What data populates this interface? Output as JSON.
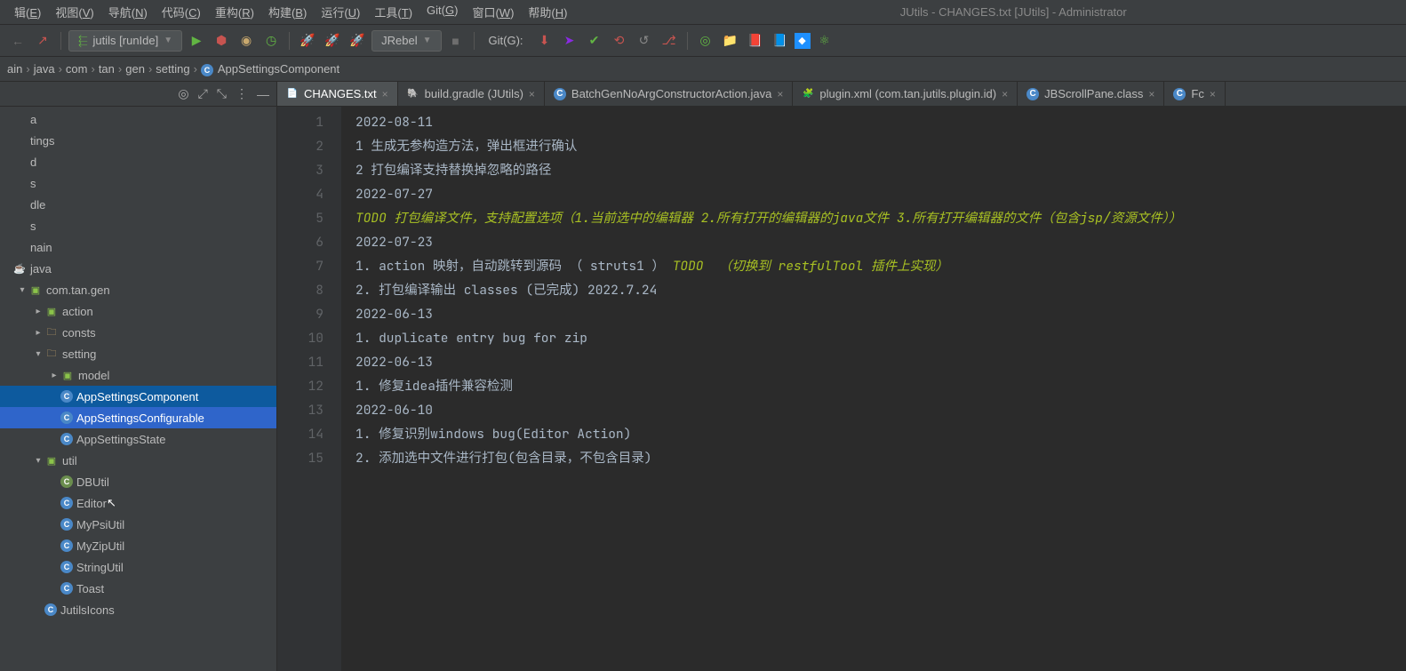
{
  "window": {
    "title": "JUtils - CHANGES.txt [JUtils] - Administrator"
  },
  "menu": {
    "items": [
      {
        "label": "辑",
        "u": "E"
      },
      {
        "label": "视图",
        "u": "V"
      },
      {
        "label": "导航",
        "u": "N"
      },
      {
        "label": "代码",
        "u": "C"
      },
      {
        "label": "重构",
        "u": "R"
      },
      {
        "label": "构建",
        "u": "B"
      },
      {
        "label": "运行",
        "u": "U"
      },
      {
        "label": "工具",
        "u": "T"
      },
      {
        "label": "Git",
        "u": "G"
      },
      {
        "label": "窗口",
        "u": "W"
      },
      {
        "label": "帮助",
        "u": "H"
      }
    ]
  },
  "toolbar": {
    "runConfig": "jutils [runIde]",
    "jrebel": "JRebel",
    "gitLabel": "Git(G):"
  },
  "breadcrumb": {
    "parts": [
      "ain",
      "java",
      "com",
      "tan",
      "gen",
      "setting"
    ],
    "last": "AppSettingsComponent"
  },
  "tree": {
    "rows": [
      {
        "depth": 0,
        "label": "a",
        "chev": "",
        "ico": ""
      },
      {
        "depth": 0,
        "label": "tings",
        "chev": "",
        "ico": ""
      },
      {
        "depth": 0,
        "label": "d",
        "chev": "",
        "ico": ""
      },
      {
        "depth": 0,
        "label": "s",
        "chev": "",
        "ico": ""
      },
      {
        "depth": 0,
        "label": "dle",
        "chev": "",
        "ico": ""
      },
      {
        "depth": 0,
        "label": "s",
        "chev": "",
        "ico": ""
      },
      {
        "depth": 0,
        "label": "nain",
        "chev": "",
        "ico": ""
      },
      {
        "depth": 0,
        "label": "java",
        "chev": "",
        "ico": "java"
      },
      {
        "depth": 1,
        "label": "com.tan.gen",
        "chev": "v",
        "ico": "pkg"
      },
      {
        "depth": 2,
        "label": "action",
        "chev": ">",
        "ico": "pkg"
      },
      {
        "depth": 2,
        "label": "consts",
        "chev": ">",
        "ico": "folder"
      },
      {
        "depth": 2,
        "label": "setting",
        "chev": "v",
        "ico": "folder"
      },
      {
        "depth": 3,
        "label": "model",
        "chev": ">",
        "ico": "pkg"
      },
      {
        "depth": 3,
        "label": "AppSettingsComponent",
        "chev": "",
        "ico": "class",
        "sel": "sel"
      },
      {
        "depth": 3,
        "label": "AppSettingsConfigurable",
        "chev": "",
        "ico": "class",
        "sel": "sel2"
      },
      {
        "depth": 3,
        "label": "AppSettingsState",
        "chev": "",
        "ico": "class"
      },
      {
        "depth": 2,
        "label": "util",
        "chev": "v",
        "ico": "pkg"
      },
      {
        "depth": 3,
        "label": "DBUtil",
        "chev": "",
        "ico": "kt"
      },
      {
        "depth": 3,
        "label": "Editor",
        "chev": "",
        "ico": "class",
        "cursor": true
      },
      {
        "depth": 3,
        "label": "MyPsiUtil",
        "chev": "",
        "ico": "class"
      },
      {
        "depth": 3,
        "label": "MyZipUtil",
        "chev": "",
        "ico": "class"
      },
      {
        "depth": 3,
        "label": "StringUtil",
        "chev": "",
        "ico": "class"
      },
      {
        "depth": 3,
        "label": "Toast",
        "chev": "",
        "ico": "class"
      },
      {
        "depth": 2,
        "label": "JutilsIcons",
        "chev": "",
        "ico": "class"
      }
    ]
  },
  "tabs": [
    {
      "name": "CHANGES.txt",
      "ico": "txt",
      "active": true
    },
    {
      "name": "build.gradle (JUtils)",
      "ico": "gradle"
    },
    {
      "name": "BatchGenNoArgConstructorAction.java",
      "ico": "class"
    },
    {
      "name": "plugin.xml (com.tan.jutils.plugin.id)",
      "ico": "xml"
    },
    {
      "name": "JBScrollPane.class",
      "ico": "class"
    },
    {
      "name": "Fc",
      "ico": "class"
    }
  ],
  "editor": {
    "lines": [
      {
        "n": 1,
        "t": "2022-08-11"
      },
      {
        "n": 2,
        "t": "1 生成无参构造方法，弹出框进行确认"
      },
      {
        "n": 3,
        "t": "2 打包编译支持替换掉忽略的路径"
      },
      {
        "n": 4,
        "t": "2022-07-27"
      },
      {
        "n": 5,
        "segs": [
          {
            "todo": true,
            "t": "TODO 打包编译文件，支持配置选项（1.当前选中的编辑器 2.所有打开的编辑器的java文件 3.所有打开编辑器的文件（包含jsp/资源文件））"
          }
        ]
      },
      {
        "n": 6,
        "t": "2022-07-23"
      },
      {
        "n": 7,
        "segs": [
          {
            "t": "1. action 映射，自动跳转到源码 （ struts1 ） "
          },
          {
            "todo": true,
            "t": "TODO  （切换到 restfulTool 插件上实现）"
          }
        ]
      },
      {
        "n": 8,
        "t": "2. 打包编译输出 classes (已完成) 2022.7.24"
      },
      {
        "n": 9,
        "t": "2022-06-13"
      },
      {
        "n": 10,
        "t": "1. duplicate entry bug for zip"
      },
      {
        "n": 11,
        "t": "2022-06-13"
      },
      {
        "n": 12,
        "t": "1. 修复idea插件兼容检测"
      },
      {
        "n": 13,
        "t": "2022-06-10"
      },
      {
        "n": 14,
        "t": "1. 修复识别windows bug(Editor Action)"
      },
      {
        "n": 15,
        "t": "2. 添加选中文件进行打包(包含目录，不包含目录)"
      }
    ]
  }
}
